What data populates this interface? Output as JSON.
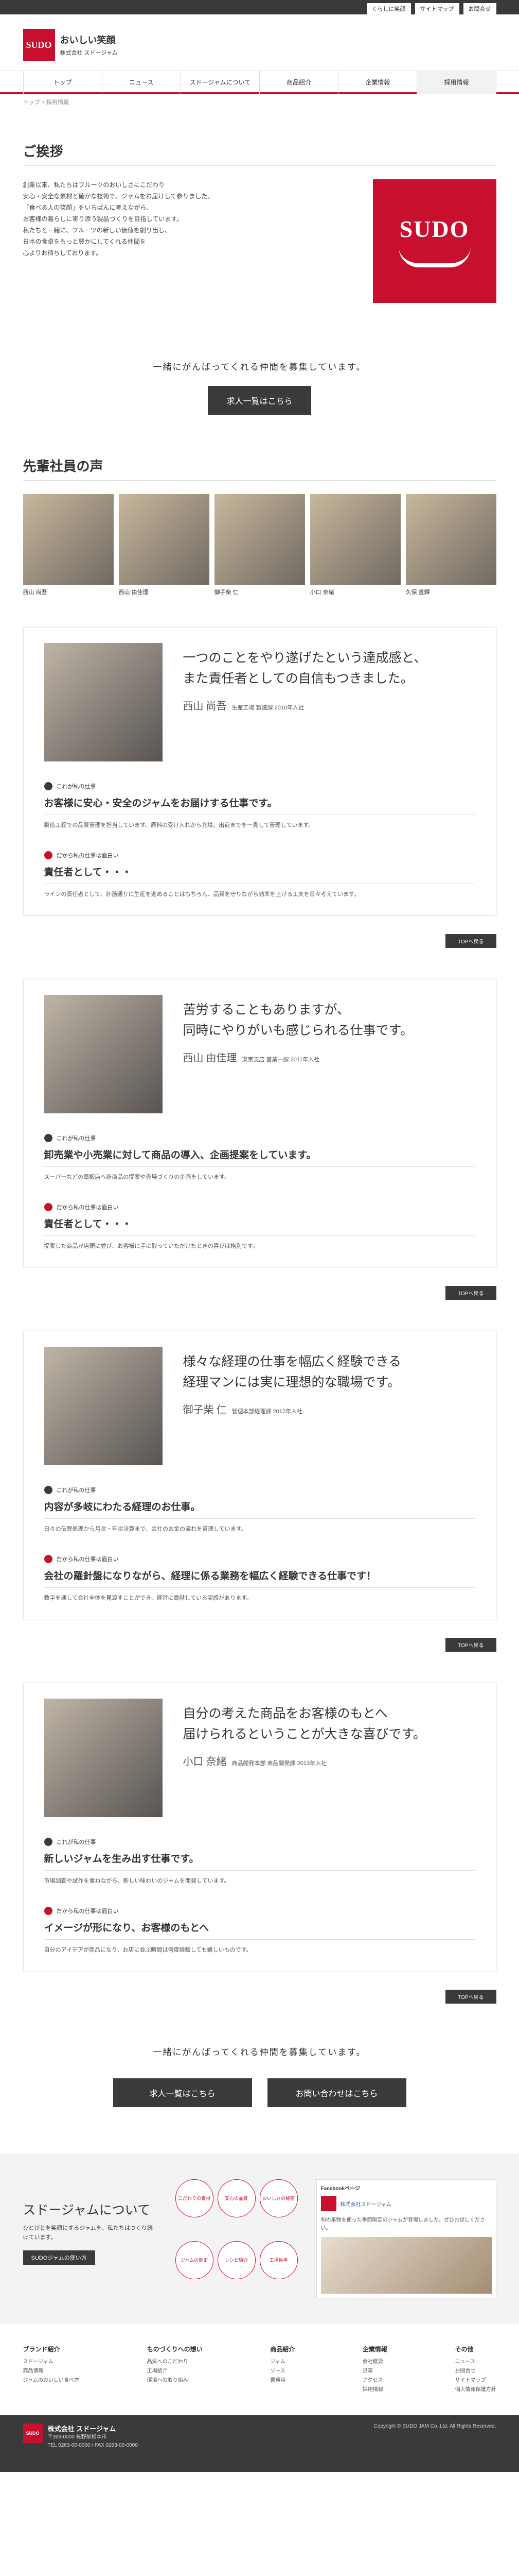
{
  "topbar": {
    "links": [
      "くらしに笑顔",
      "サイトマップ",
      "お問合せ"
    ]
  },
  "header": {
    "logo_mark": "SUDO",
    "tagline": "おいしい笑顔",
    "company": "株式会社 スドージャム"
  },
  "nav": [
    "トップ",
    "ニュース",
    "スドージャムについて",
    "商品紹介",
    "企業情報",
    "採用情報"
  ],
  "breadcrumb": "トップ > 採用情報",
  "greeting": {
    "title": "ご挨拶",
    "paragraphs": [
      "創業以来、私たちはフルーツのおいしさにこだわり",
      "安心・安全な素材と確かな技術で、ジャムをお届けして参りました。",
      "「食べる人の笑顔」をいちばんに考えながら、",
      "お客様の暮らしに寄り添う製品づくりを目指しています。",
      "私たちと一緒に、フルーツの新しい価値を創り出し、",
      "日本の食卓をもっと豊かにしてくれる仲間を",
      "心よりお待ちしております。"
    ],
    "logo_text": "SUDO"
  },
  "cta": {
    "message": "一緒にがんばってくれる仲間を募集しています。",
    "button": "求人一覧はこちら",
    "contact": "お問い合わせはこちら"
  },
  "voices": {
    "title": "先輩社員の声",
    "thumbs": [
      {
        "cap": "西山 尚吾"
      },
      {
        "cap": "西山 由佳理"
      },
      {
        "cap": "御子柴 仁"
      },
      {
        "cap": "小口 奈緒"
      },
      {
        "cap": "久保 直輝"
      }
    ]
  },
  "interviews": [
    {
      "lead1": "一つのことをやり遂げたという達成感と、",
      "lead2": "また責任者としての自信もつきました。",
      "name": "西山 尚吾",
      "dept": "生産工場 製造課 2010年入社",
      "q1": "これが私の仕事",
      "a1": "お客様に安心・安全のジャムをお届けする仕事です。",
      "t1": "製造工程での品質管理を担当しています。原料の受け入れから充填、出荷までを一貫して管理しています。",
      "q2": "だから私の仕事は面白い",
      "a2": "責任者として・・・",
      "t2": "ラインの責任者として、計画通りに生産を進めることはもちろん、品質を守りながら効率を上げる工夫を日々考えています。"
    },
    {
      "lead1": "苦労することもありますが、",
      "lead2": "同時にやりがいも感じられる仕事です。",
      "name": "西山 由佳理",
      "dept": "東京支店 営業一課 2011年入社",
      "q1": "これが私の仕事",
      "a1": "卸売業や小売業に対して商品の導入、企画提案をしています。",
      "t1": "スーパーなどの量販店へ新商品の提案や売場づくりの企画をしています。",
      "q2": "だから私の仕事は面白い",
      "a2": "責任者として・・・",
      "t2": "提案した商品が店頭に並び、お客様に手に取っていただけたときの喜びは格別です。"
    },
    {
      "lead1": "様々な経理の仕事を幅広く経験できる",
      "lead2": "経理マンには実に理想的な職場です。",
      "name": "御子柴 仁",
      "dept": "管理本部経理課 2012年入社",
      "q1": "これが私の仕事",
      "a1": "内容が多岐にわたる経理のお仕事。",
      "t1": "日々の伝票処理から月次・年次決算まで、会社のお金の流れを管理しています。",
      "q2": "だから私の仕事は面白い",
      "a2": "会社の羅針盤になりながら、経理に係る業務を幅広く経験できる仕事です！",
      "t2": "数字を通して会社全体を見渡すことができ、経営に貢献している実感があります。"
    },
    {
      "lead1": "自分の考えた商品をお客様のもとへ",
      "lead2": "届けられるということが大きな喜びです。",
      "name": "小口 奈緒",
      "dept": "商品開発本部 商品開発課 2013年入社",
      "q1": "これが私の仕事",
      "a1": "新しいジャムを生み出す仕事です。",
      "t1": "市場調査や試作を重ねながら、新しい味わいのジャムを開発しています。",
      "q2": "だから私の仕事は面白い",
      "a2": "イメージが形になり、お客様のもとへ",
      "t2": "自分のアイデアが商品になり、お店に並ぶ瞬間は何度経験しても嬉しいものです。"
    }
  ],
  "pagetop": "TOPへ戻る",
  "about": {
    "title": "スドージャムについて",
    "text": "ひとびとを笑顔にするジャムを、私たちはつくり続けています。",
    "link": "SUDOジャムの使い方",
    "circles": [
      "こだわりの素材",
      "安心の品質",
      "おいしさの秘密",
      "ジャムの歴史",
      "レシピ紹介",
      "工場見学"
    ]
  },
  "facebook": {
    "title": "Facebookページ",
    "page": "株式会社スドージャム",
    "post": "旬の果物を使った季節限定のジャムが登場しました。ぜひお試しください。"
  },
  "sitemap": [
    {
      "h": "ブランド紹介",
      "items": [
        "スドージャム",
        "商品情報",
        "ジャムのおいしい食べ方"
      ]
    },
    {
      "h": "ものづくりへの想い",
      "items": [
        "品質へのこだわり",
        "工場紹介",
        "環境への取り組み"
      ]
    },
    {
      "h": "商品紹介",
      "items": [
        "ジャム",
        "ソース",
        "業務用"
      ]
    },
    {
      "h": "企業情報",
      "items": [
        "会社概要",
        "沿革",
        "アクセス",
        "採用情報"
      ]
    },
    {
      "h": "その他",
      "items": [
        "ニュース",
        "お問合せ",
        "サイトマップ",
        "個人情報保護方針"
      ]
    }
  ],
  "footer": {
    "logo": "SUDO",
    "name": "株式会社 スドージャム",
    "address": "〒399-0000 長野県松本市",
    "tel": "TEL 0263-00-0000 / FAX 0263-00-0000",
    "copy": "Copyright © SUDO JAM Co.,Ltd. All Rights Reserved."
  }
}
